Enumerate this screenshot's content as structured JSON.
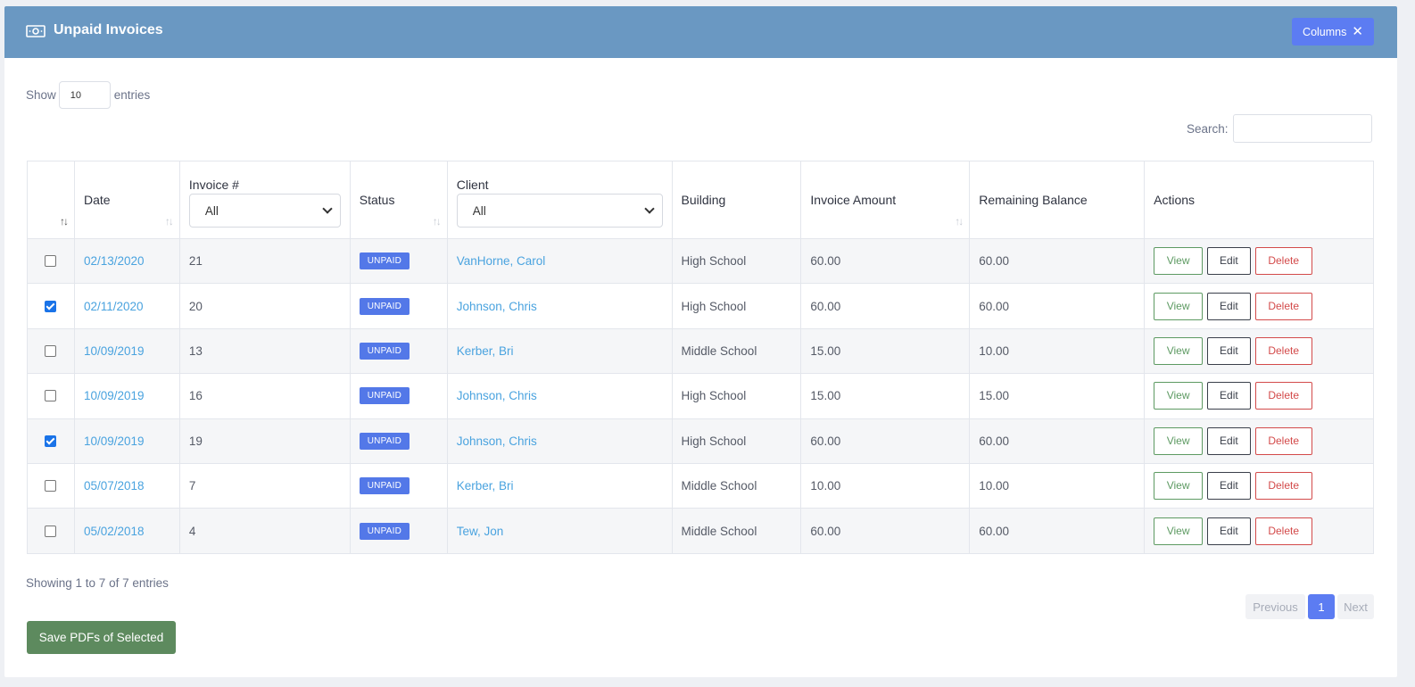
{
  "header": {
    "title": "Unpaid Invoices",
    "columns_label": "Columns",
    "close_glyph": "✕",
    "icon": "money-bill-icon"
  },
  "length": {
    "show_label": "Show",
    "value": "10",
    "entries_label": "entries"
  },
  "search": {
    "label": "Search:",
    "value": ""
  },
  "table": {
    "columns": [
      {
        "key": "select",
        "label": ""
      },
      {
        "key": "date",
        "label": "Date"
      },
      {
        "key": "invoice",
        "label": "Invoice #",
        "filter": "All"
      },
      {
        "key": "status",
        "label": "Status"
      },
      {
        "key": "client",
        "label": "Client",
        "filter": "All"
      },
      {
        "key": "building",
        "label": "Building"
      },
      {
        "key": "amount",
        "label": "Invoice Amount"
      },
      {
        "key": "balance",
        "label": "Remaining Balance"
      },
      {
        "key": "actions",
        "label": "Actions"
      }
    ],
    "rows": [
      {
        "checked": false,
        "date": "02/13/2020",
        "invoice": "21",
        "status": "UNPAID",
        "client": "VanHorne, Carol",
        "building": "High School",
        "amount": "60.00",
        "balance": "60.00"
      },
      {
        "checked": true,
        "date": "02/11/2020",
        "invoice": "20",
        "status": "UNPAID",
        "client": "Johnson, Chris",
        "building": "High School",
        "amount": "60.00",
        "balance": "60.00"
      },
      {
        "checked": false,
        "date": "10/09/2019",
        "invoice": "13",
        "status": "UNPAID",
        "client": "Kerber, Bri",
        "building": "Middle School",
        "amount": "15.00",
        "balance": "10.00"
      },
      {
        "checked": false,
        "date": "10/09/2019",
        "invoice": "16",
        "status": "UNPAID",
        "client": "Johnson, Chris",
        "building": "High School",
        "amount": "15.00",
        "balance": "15.00"
      },
      {
        "checked": true,
        "date": "10/09/2019",
        "invoice": "19",
        "status": "UNPAID",
        "client": "Johnson, Chris",
        "building": "High School",
        "amount": "60.00",
        "balance": "60.00"
      },
      {
        "checked": false,
        "date": "05/07/2018",
        "invoice": "7",
        "status": "UNPAID",
        "client": "Kerber, Bri",
        "building": "Middle School",
        "amount": "10.00",
        "balance": "10.00"
      },
      {
        "checked": false,
        "date": "05/02/2018",
        "invoice": "4",
        "status": "UNPAID",
        "client": "Tew, Jon",
        "building": "Middle School",
        "amount": "60.00",
        "balance": "60.00"
      }
    ],
    "actions": {
      "view": "View",
      "edit": "Edit",
      "delete": "Delete"
    }
  },
  "footer": {
    "info": "Showing 1 to 7 of 7 entries",
    "prev": "Previous",
    "page": "1",
    "next": "Next",
    "save_label": "Save PDFs of Selected"
  },
  "colors": {
    "header_bg": "#6a98c2",
    "accent": "#5c7cf2",
    "link": "#4aa3df",
    "badge": "#5378e8",
    "save": "#5d8a5e",
    "danger": "#d34a4a",
    "success": "#5d9a62"
  }
}
